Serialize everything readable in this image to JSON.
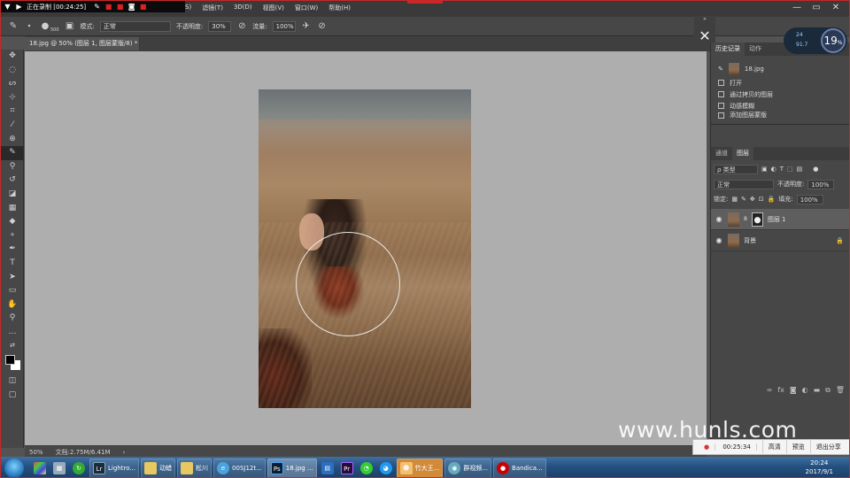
{
  "recorder": {
    "status": "正在录制 [00:24:25]",
    "popup_time": "00:25:34",
    "popup_buttons": [
      "高清",
      "预览",
      "退出分享"
    ]
  },
  "menu": {
    "items": [
      "S)",
      "滤镜(T)",
      "3D(D)",
      "视图(V)",
      "窗口(W)",
      "帮助(H)"
    ]
  },
  "options": {
    "brush_size": "500",
    "mode_label": "模式:",
    "mode_value": "正常",
    "opacity_label": "不透明度:",
    "opacity_value": "30%",
    "flow_label": "流量:",
    "flow_value": "100%"
  },
  "document": {
    "tab_title": "18.jpg @ 50% (图层 1, 图层蒙版/8) *",
    "zoom": "50%",
    "doc_size": "文档:2.75M/6.41M"
  },
  "history_panel": {
    "tabs": [
      "历史记录",
      "动作"
    ],
    "snapshot": "18.jpg",
    "steps": [
      "打开",
      "通过拷贝的图层",
      "动感模糊",
      "添加图层蒙版"
    ]
  },
  "layers_panel": {
    "tabs": [
      "通道",
      "图层"
    ],
    "filter_kind": "ρ 类型",
    "blend_mode": "正常",
    "opacity_label": "不透明度:",
    "opacity_value": "100%",
    "lock_label": "锁定:",
    "fill_label": "填充:",
    "fill_value": "100%",
    "layers": [
      {
        "name": "图层 1"
      },
      {
        "name": "背景"
      }
    ]
  },
  "speed_widget": {
    "up": "24",
    "down": "91.7",
    "percent": "19",
    "percent_unit": "%"
  },
  "watermark": "www.hunls.com",
  "taskbar": {
    "items": [
      "Lightro...",
      "动蜡",
      "松川",
      "00SJ12t...",
      "18.jpg ...",
      "竹大王...",
      "群视频...",
      "Bandica..."
    ],
    "clock_time": "20:24",
    "clock_date": "2017/9/1"
  },
  "icons": {
    "colors": {
      "accent_red": "#c82828",
      "canvas_bg": "#aeaeae",
      "panel_bg": "#474747"
    }
  }
}
